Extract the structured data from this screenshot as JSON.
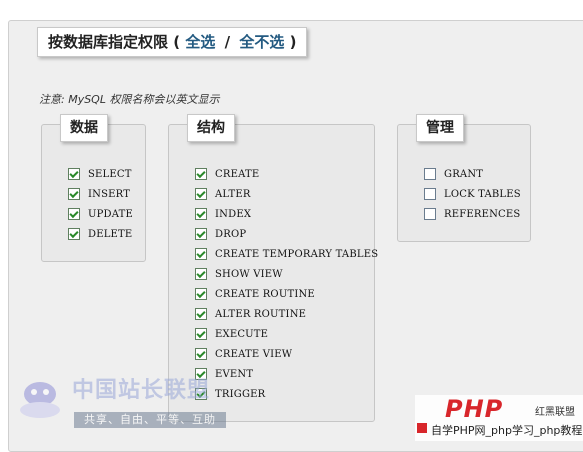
{
  "header": {
    "title": "按数据库指定权限",
    "open_paren": "(",
    "select_all": "全选",
    "separator": "/",
    "select_none": "全不选",
    "close_paren": ")"
  },
  "note": "注意: MySQL 权限名称会以英文显示",
  "groups": [
    {
      "title": "数据",
      "items": [
        {
          "label": "SELECT",
          "checked": true
        },
        {
          "label": "INSERT",
          "checked": true
        },
        {
          "label": "UPDATE",
          "checked": true
        },
        {
          "label": "DELETE",
          "checked": true
        }
      ]
    },
    {
      "title": "结构",
      "items": [
        {
          "label": "CREATE",
          "checked": true
        },
        {
          "label": "ALTER",
          "checked": true
        },
        {
          "label": "INDEX",
          "checked": true
        },
        {
          "label": "DROP",
          "checked": true
        },
        {
          "label": "CREATE TEMPORARY TABLES",
          "checked": true
        },
        {
          "label": "SHOW VIEW",
          "checked": true
        },
        {
          "label": "CREATE ROUTINE",
          "checked": true
        },
        {
          "label": "ALTER ROUTINE",
          "checked": true
        },
        {
          "label": "EXECUTE",
          "checked": true
        },
        {
          "label": "CREATE VIEW",
          "checked": true
        },
        {
          "label": "EVENT",
          "checked": true
        },
        {
          "label": "TRIGGER",
          "checked": true
        }
      ]
    },
    {
      "title": "管理",
      "items": [
        {
          "label": "GRANT",
          "checked": false
        },
        {
          "label": "LOCK TABLES",
          "checked": false
        },
        {
          "label": "REFERENCES",
          "checked": false
        }
      ]
    }
  ],
  "watermarks": {
    "left_site": "中国站长联盟",
    "left_slogan": "共享、自由、平等、互助",
    "right_logo": "PHP",
    "right_brand": "红黑联盟",
    "right_caption": "自学PHP网_php学习_php教程"
  },
  "colors": {
    "link": "#235a81",
    "checkbox_check": "#2a8a2a",
    "panel_bg": "#efefef"
  }
}
